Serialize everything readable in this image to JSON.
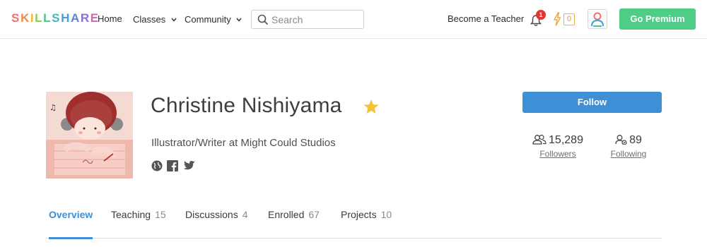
{
  "header": {
    "logo": {
      "letters": [
        "S",
        "K",
        "I",
        "L",
        "L",
        "S",
        "H",
        "A",
        "R",
        "E"
      ],
      "colors": [
        "#f26f6f",
        "#f28a4d",
        "#f4b73b",
        "#8ccd5b",
        "#4fc38e",
        "#3fb9c4",
        "#3ea1dd",
        "#5d84d8",
        "#8a6fd4",
        "#d266b3"
      ]
    },
    "nav": {
      "home": "Home",
      "classes": "Classes",
      "community": "Community"
    },
    "search": {
      "placeholder": "Search",
      "value": ""
    },
    "become_teacher": "Become a Teacher",
    "notifications_count": "1",
    "points_count": "0",
    "go_premium": "Go Premium"
  },
  "profile": {
    "name": "Christine Nishiyama",
    "headline": "Illustrator/Writer at Might Could Studios",
    "follow_label": "Follow",
    "followers": {
      "count": "15,289",
      "label": "Followers"
    },
    "following": {
      "count": "89",
      "label": "Following"
    }
  },
  "tabs": [
    {
      "label": "Overview",
      "count": ""
    },
    {
      "label": "Teaching",
      "count": "15"
    },
    {
      "label": "Discussions",
      "count": "4"
    },
    {
      "label": "Enrolled",
      "count": "67"
    },
    {
      "label": "Projects",
      "count": "10"
    }
  ],
  "colors": {
    "accent": "#3d8fd6",
    "premium": "#4ecd86",
    "badge": "#e2352f",
    "star": "#f5c33b"
  },
  "icons": {
    "search": "search-icon",
    "bell": "bell-icon",
    "points": "lightning-icon",
    "user": "user-icon",
    "star": "star-icon",
    "website": "globe-icon",
    "facebook": "facebook-icon",
    "twitter": "twitter-icon"
  }
}
